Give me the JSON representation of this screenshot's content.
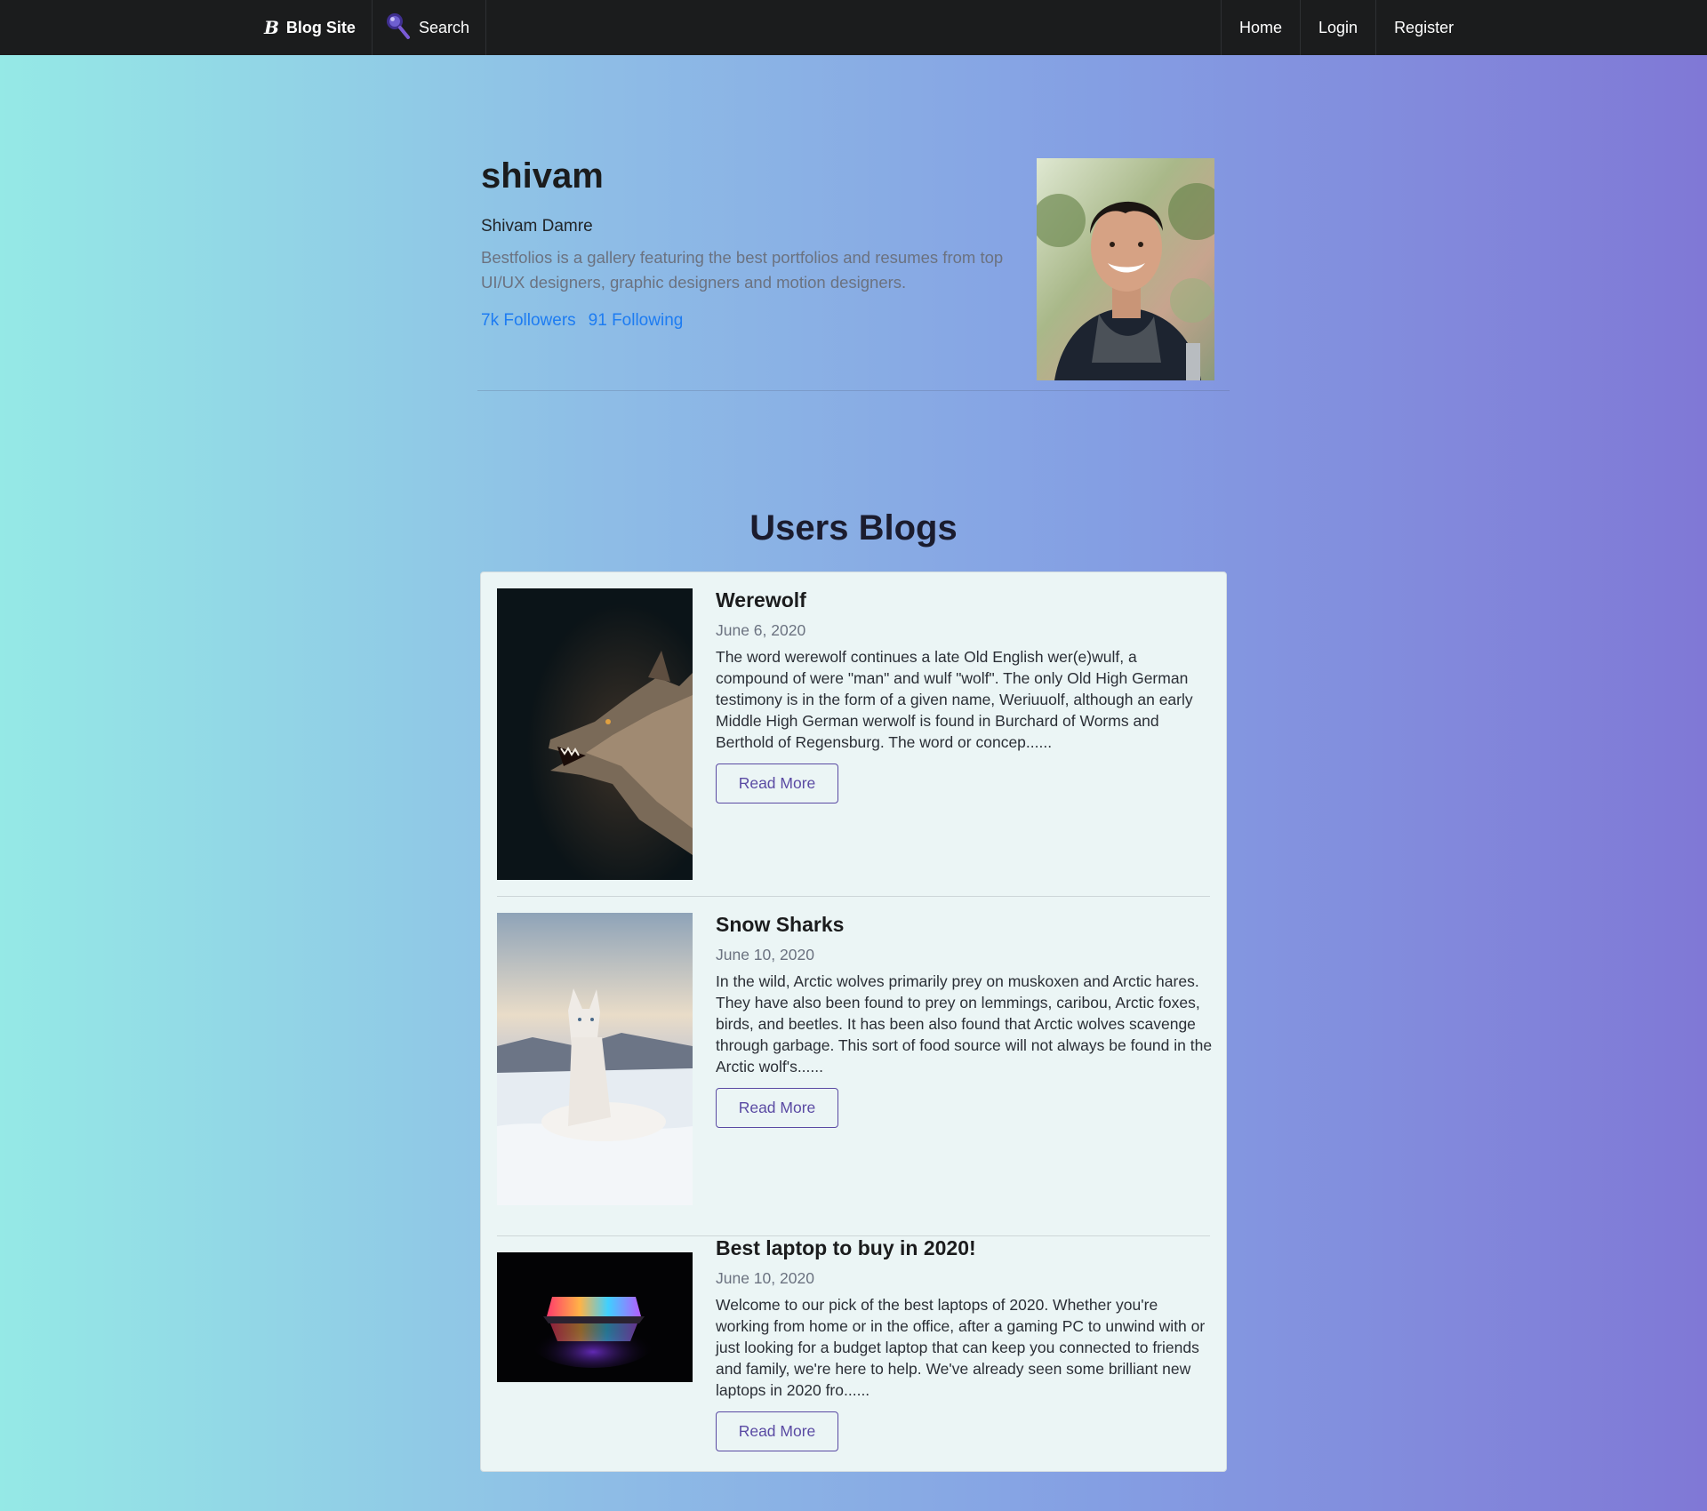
{
  "navbar": {
    "brand_label": "Blog Site",
    "brand_glyph": "B",
    "search_label": "Search",
    "items": [
      {
        "label": "Home"
      },
      {
        "label": "Login"
      },
      {
        "label": "Register"
      }
    ]
  },
  "profile": {
    "username": "shivam",
    "full_name": "Shivam Damre",
    "bio": "Bestfolios is a gallery featuring the best portfolios and resumes from top UI/UX designers, graphic designers and motion designers.",
    "followers": "7k Followers",
    "following": "91 Following"
  },
  "blogs_section": {
    "title": "Users Blogs",
    "read_more_label": "Read More",
    "posts": [
      {
        "title": "Werewolf",
        "date": "June 6, 2020",
        "excerpt": "The word werewolf continues a late Old English wer(e)wulf, a compound of were \"man\" and wulf \"wolf\". The only Old High German testimony is in the form of a given name, Weriuuolf, although an early Middle High German werwolf is found in Burchard of Worms and Berthold of Regensburg. The word or concep......",
        "read_more": "Read More"
      },
      {
        "title": "Snow Sharks",
        "date": "June 10, 2020",
        "excerpt": "In the wild, Arctic wolves primarily prey on muskoxen and Arctic hares. They have also been found to prey on lemmings, caribou, Arctic foxes, birds, and beetles. It has been also found that Arctic wolves scavenge through garbage. This sort of food source will not always be found in the Arctic wolf's......",
        "read_more": "Read More"
      },
      {
        "title": "Best laptop to buy in 2020!",
        "date": "June 10, 2020",
        "excerpt": "Welcome to our pick of the best laptops of 2020. Whether you're working from home or in the office, after a gaming PC to unwind with or just looking for a budget laptop that can keep you connected to friends and family, we're here to help. We've already seen some brilliant new laptops in 2020 fro......",
        "read_more": "Read More"
      }
    ]
  }
}
